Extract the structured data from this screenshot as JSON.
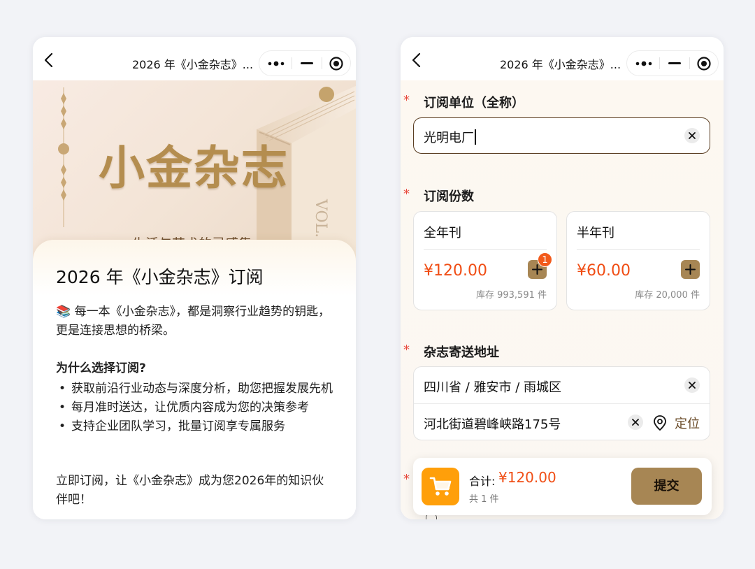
{
  "left_screen": {
    "navbar": {
      "title": "2026 年《小金杂志》..."
    },
    "hero": {
      "title": "小金杂志",
      "subtitle": "生活与艺术的灵感集",
      "book_spine_text": "VOL."
    },
    "article": {
      "heading": "2026 年《小金杂志》订阅",
      "intro_emoji": "📚",
      "intro": "每一本《小金杂志》，都是洞察行业趋势的钥匙，更是连接思想的桥梁。",
      "why_title": "为什么选择订阅?",
      "bullets": [
        "获取前沿行业动态与深度分析，助您把握发展先机",
        "每月准时送达，让优质内容成为您的决策参考",
        "支持企业团队学习，批量订阅享专属服务"
      ],
      "closing": "立即订阅，让《小金杂志》成为您2026年的知识伙伴吧！"
    }
  },
  "right_screen": {
    "navbar": {
      "title": "2026 年《小金杂志》..."
    },
    "form": {
      "required_mark": "*",
      "unit_label": "订阅单位（全称）",
      "unit_value": "光明电厂",
      "copies_label": "订阅份数",
      "plans": [
        {
          "name": "全年刊",
          "price": "¥120.00",
          "stock": "库存 993,591 件",
          "badge": "1"
        },
        {
          "name": "半年刊",
          "price": "¥60.00",
          "stock": "库存 20,000 件",
          "badge": ""
        }
      ],
      "address_label": "杂志寄送地址",
      "region_value": "四川省 / 雅安市 / 雨城区",
      "street_value": "河北街道碧峰峡路175号",
      "locate_label": "定位"
    },
    "bottom_bar": {
      "total_label": "合计:",
      "total_value": "¥120.00",
      "count_text": "共 1 件",
      "submit_label": "提交"
    }
  },
  "colors": {
    "page_bg": "#f2f3f7",
    "accent_gold": "#a78654",
    "price_orange": "#f04d14",
    "required_red": "#e84a3c",
    "cart_orange": "#ff9f0a"
  },
  "icons": [
    "back-arrow-icon",
    "more-dots-icon",
    "minimize-icon",
    "close-target-icon",
    "clear-icon",
    "plus-icon",
    "location-pin-icon",
    "shopping-cart-icon"
  ]
}
